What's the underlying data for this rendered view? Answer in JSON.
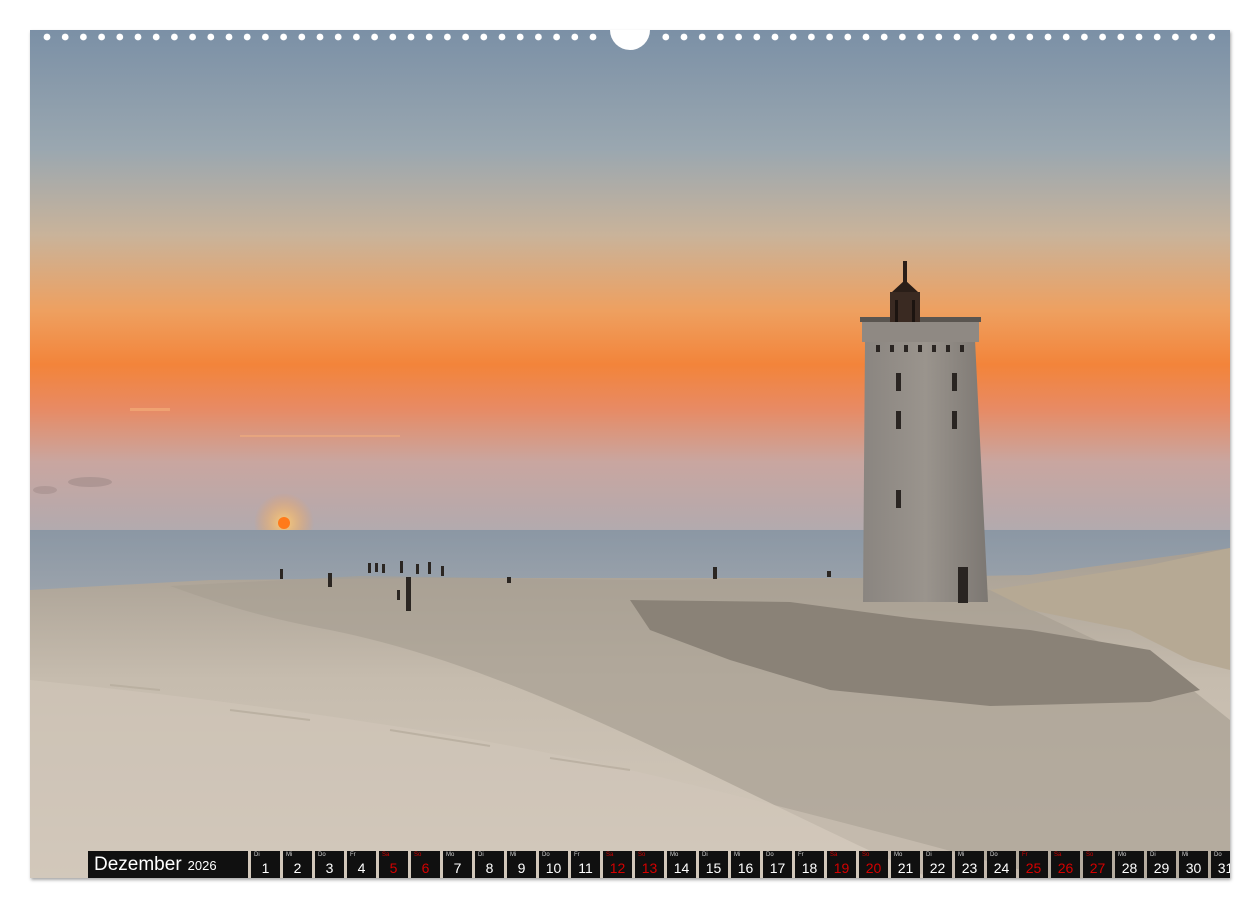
{
  "calendar": {
    "month": "Dezember",
    "year": "2026",
    "days": [
      {
        "n": "1",
        "wd": "Di",
        "red": false
      },
      {
        "n": "2",
        "wd": "Mi",
        "red": false
      },
      {
        "n": "3",
        "wd": "Do",
        "red": false
      },
      {
        "n": "4",
        "wd": "Fr",
        "red": false
      },
      {
        "n": "5",
        "wd": "Sa",
        "red": true
      },
      {
        "n": "6",
        "wd": "So",
        "red": true
      },
      {
        "n": "7",
        "wd": "Mo",
        "red": false
      },
      {
        "n": "8",
        "wd": "Di",
        "red": false
      },
      {
        "n": "9",
        "wd": "Mi",
        "red": false
      },
      {
        "n": "10",
        "wd": "Do",
        "red": false
      },
      {
        "n": "11",
        "wd": "Fr",
        "red": false
      },
      {
        "n": "12",
        "wd": "Sa",
        "red": true
      },
      {
        "n": "13",
        "wd": "So",
        "red": true
      },
      {
        "n": "14",
        "wd": "Mo",
        "red": false
      },
      {
        "n": "15",
        "wd": "Di",
        "red": false
      },
      {
        "n": "16",
        "wd": "Mi",
        "red": false
      },
      {
        "n": "17",
        "wd": "Do",
        "red": false
      },
      {
        "n": "18",
        "wd": "Fr",
        "red": false
      },
      {
        "n": "19",
        "wd": "Sa",
        "red": true
      },
      {
        "n": "20",
        "wd": "So",
        "red": true
      },
      {
        "n": "21",
        "wd": "Mo",
        "red": false
      },
      {
        "n": "22",
        "wd": "Di",
        "red": false
      },
      {
        "n": "23",
        "wd": "Mi",
        "red": false
      },
      {
        "n": "24",
        "wd": "Do",
        "red": false
      },
      {
        "n": "25",
        "wd": "Fr",
        "red": true
      },
      {
        "n": "26",
        "wd": "Sa",
        "red": true
      },
      {
        "n": "27",
        "wd": "So",
        "red": true
      },
      {
        "n": "28",
        "wd": "Mo",
        "red": false
      },
      {
        "n": "29",
        "wd": "Di",
        "red": false
      },
      {
        "n": "30",
        "wd": "Mi",
        "red": false
      },
      {
        "n": "31",
        "wd": "Do",
        "red": false
      }
    ]
  },
  "colors": {
    "sky_top": "#7e93a8",
    "sky_horizon": "#f1903c",
    "sea": "#8f9aa4",
    "sand": "#c9bfb2",
    "weekend": "#d40000",
    "bar": "#101010"
  },
  "icons": {
    "binding": "spiral-binding-holes",
    "photo": "lighthouse-sunset-photo"
  }
}
